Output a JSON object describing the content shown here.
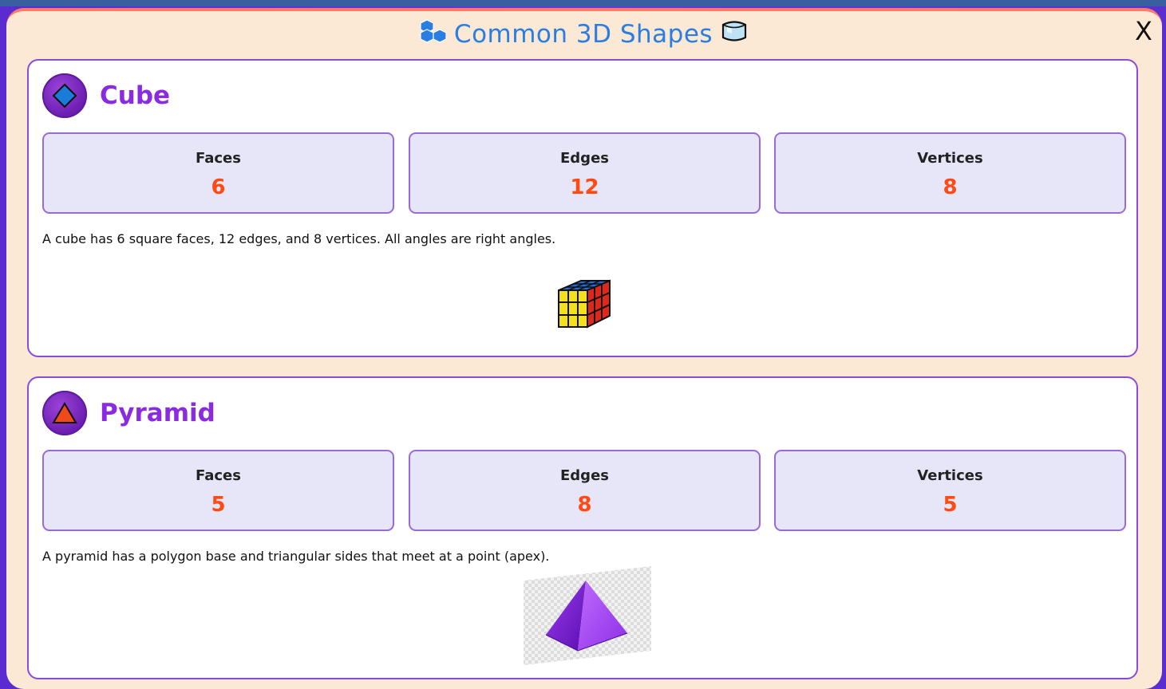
{
  "modal": {
    "title": "Common 3D Shapes",
    "title_icon_left": "blocks-icon",
    "title_icon_right": "ice-cube-icon",
    "close_label": "X"
  },
  "shapes": [
    {
      "name": "Cube",
      "icon": "diamond-icon",
      "stats": [
        {
          "label": "Faces",
          "value": "6"
        },
        {
          "label": "Edges",
          "value": "12"
        },
        {
          "label": "Vertices",
          "value": "8"
        }
      ],
      "description": "A cube has 6 square faces, 12 edges, and 8 vertices. All angles are right angles.",
      "image": "rubiks-cube-image"
    },
    {
      "name": "Pyramid",
      "icon": "triangle-icon",
      "stats": [
        {
          "label": "Faces",
          "value": "5"
        },
        {
          "label": "Edges",
          "value": "8"
        },
        {
          "label": "Vertices",
          "value": "5"
        }
      ],
      "description": "A pyramid has a polygon base and triangular sides that meet at a point (apex).",
      "image": "purple-pyramid-image"
    }
  ],
  "colors": {
    "accent": "#8a2be2",
    "value": "#ff4a12",
    "title": "#2a7de1",
    "modal_bg": "#fbe9d6"
  }
}
